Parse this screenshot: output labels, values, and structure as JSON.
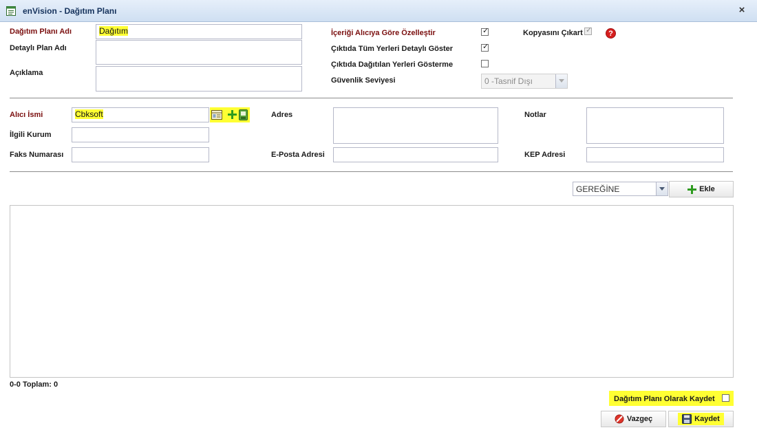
{
  "window": {
    "title": "enVision - Dağıtım Planı",
    "close_label": "×"
  },
  "plan": {
    "name_label": "Dağıtım Planı Adı",
    "name_value": "Dağıtım",
    "detail_label": "Detaylı Plan Adı",
    "detail_value": "",
    "description_label": "Açıklama",
    "description_value": ""
  },
  "options": {
    "customize_label": "İçeriği Alıcıya Göre Özelleştir",
    "customize_checked": true,
    "show_all_detailed_label": "Çıktıda Tüm Yerleri Detaylı Göster",
    "show_all_detailed_checked": true,
    "hide_distributed_label": "Çıktıda Dağıtılan Yerleri Gösterme",
    "hide_distributed_checked": false,
    "security_label": "Güvenlik Seviyesi",
    "security_value": "0  -Tasnif Dışı",
    "copy_label": "Kopyasını Çıkart",
    "copy_checked": true,
    "help_glyph": "?",
    "check_glyph": "✓"
  },
  "recipient": {
    "name_label": "Alıcı İsmi",
    "name_value": "Cbksoft",
    "institution_label": "İlgili Kurum",
    "institution_value": "",
    "fax_label": "Faks Numarası",
    "fax_value": "",
    "address_label": "Adres",
    "address_value": "",
    "email_label": "E-Posta Adresi",
    "email_value": "",
    "notes_label": "Notlar",
    "notes_value": "",
    "kep_label": "KEP Adresi",
    "kep_value": ""
  },
  "list": {
    "type_value": "GEREĞİNE",
    "add_label": "Ekle",
    "paging_text": "0-0 Toplam: 0"
  },
  "footer": {
    "save_as_plan_label": "Dağıtım Planı Olarak Kaydet",
    "save_as_plan_checked": false,
    "cancel_label": "Vazgeç",
    "save_label": "Kaydet"
  },
  "colors": {
    "highlight": "#ffff33",
    "required_label": "#7a0e0e",
    "title_text": "#15325c"
  }
}
